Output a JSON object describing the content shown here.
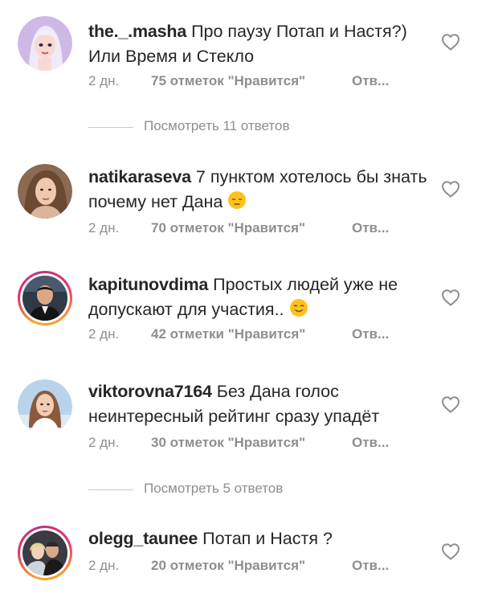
{
  "comments": [
    {
      "username": "the._.masha",
      "text": "Про паузу Потап и Настя?) Или Время и Стекло",
      "time": "2 дн.",
      "likes": "75 отметок \"Нравится\"",
      "reply": "Отв..."
    },
    {
      "username": "natikaraseva",
      "text": "7 пунктом хотелось бы знать почему нет Дана",
      "time": "2 дн.",
      "likes": "70 отметок \"Нравится\"",
      "reply": "Отв..."
    },
    {
      "username": "kapitunovdima",
      "text": "Простых людей уже не допускают для участия..",
      "time": "2 дн.",
      "likes": "42 отметки \"Нравится\"",
      "reply": "Отв..."
    },
    {
      "username": "viktorovna7164",
      "text": "Без Дана голос неинтересный рейтинг сразу упадёт",
      "time": "2 дн.",
      "likes": "30 отметок \"Нравится\"",
      "reply": "Отв..."
    },
    {
      "username": "olegg_taunee",
      "text": "Потап и Настя ?",
      "time": "2 дн.",
      "likes": "20 отметок \"Нравится\"",
      "reply": "Отв..."
    }
  ],
  "view_replies": [
    {
      "label": "Посмотреть 11 ответов"
    },
    {
      "label": "Посмотреть 5 ответов"
    }
  ],
  "icons": {
    "heart": "heart-outline-icon",
    "emoji_pensive": "pensive-face-emoji",
    "emoji_smile": "smiling-face-emoji"
  },
  "colors": {
    "text": "#262626",
    "secondary": "#8e8e8e",
    "divider": "#c7c7c7"
  }
}
